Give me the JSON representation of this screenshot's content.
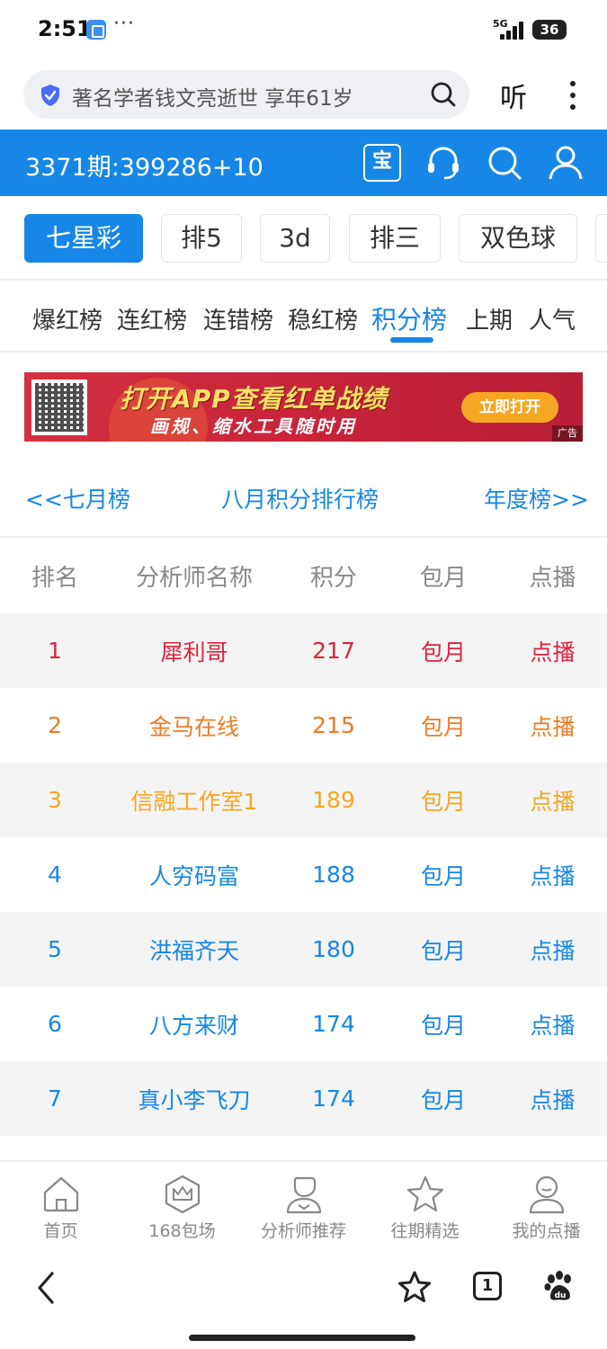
{
  "status_bar": {
    "time": "2:51",
    "dots": "···",
    "network": "5G",
    "battery": "36"
  },
  "browser": {
    "address_text": "著名学者钱文亮逝世 享年61岁",
    "listen_label": "听"
  },
  "header": {
    "issue_text": "3371期:399286+10",
    "bao_label": "宝"
  },
  "lottery_tabs": [
    {
      "label": "七星彩",
      "active": true
    },
    {
      "label": "排5",
      "active": false
    },
    {
      "label": "3d",
      "active": false
    },
    {
      "label": "排三",
      "active": false
    },
    {
      "label": "双色球",
      "active": false
    }
  ],
  "rank_tabs": [
    {
      "label": "爆红榜",
      "active": false
    },
    {
      "label": "连红榜",
      "active": false
    },
    {
      "label": "连错榜",
      "active": false
    },
    {
      "label": "稳红榜",
      "active": false
    },
    {
      "label": "积分榜",
      "active": true
    },
    {
      "label": "上期",
      "active": false
    },
    {
      "label": "人气",
      "active": false
    }
  ],
  "ad": {
    "title": "打开APP查看红单战绩",
    "subtitle": "画规、缩水工具随时用",
    "button": "立即打开",
    "tag": "广告"
  },
  "month_nav": {
    "prev": "<<七月榜",
    "current": "八月积分排行榜",
    "next": "年度榜>>"
  },
  "table": {
    "headers": [
      "排名",
      "分析师名称",
      "积分",
      "包月",
      "点播"
    ],
    "rows": [
      {
        "rank": "1",
        "name": "犀利哥",
        "score": "217",
        "monthly": "包月",
        "play": "点播",
        "color": "#e0233a"
      },
      {
        "rank": "2",
        "name": "金马在线",
        "score": "215",
        "monthly": "包月",
        "play": "点播",
        "color": "#ee7b22"
      },
      {
        "rank": "3",
        "name": "信融工作室1",
        "score": "189",
        "monthly": "包月",
        "play": "点播",
        "color": "#f5a623"
      },
      {
        "rank": "4",
        "name": "人穷码富",
        "score": "188",
        "monthly": "包月",
        "play": "点播",
        "color": "#1687e6"
      },
      {
        "rank": "5",
        "name": "洪福齐天",
        "score": "180",
        "monthly": "包月",
        "play": "点播",
        "color": "#1687e6"
      },
      {
        "rank": "6",
        "name": "八方来财",
        "score": "174",
        "monthly": "包月",
        "play": "点播",
        "color": "#1687e6"
      },
      {
        "rank": "7",
        "name": "真小李飞刀",
        "score": "174",
        "monthly": "包月",
        "play": "点播",
        "color": "#1687e6"
      }
    ]
  },
  "bottom_nav": [
    {
      "label": "首页",
      "icon": "home-icon"
    },
    {
      "label": "168包场",
      "icon": "crown-icon"
    },
    {
      "label": "分析师推荐",
      "icon": "analyst-icon"
    },
    {
      "label": "往期精选",
      "icon": "star-icon"
    },
    {
      "label": "我的点播",
      "icon": "user-icon"
    }
  ],
  "system_bar": {
    "tab_count": "1"
  },
  "colors": {
    "accent": "#1687e6",
    "rank1": "#e0233a",
    "rank2": "#ee7b22",
    "rank3": "#f5a623"
  }
}
